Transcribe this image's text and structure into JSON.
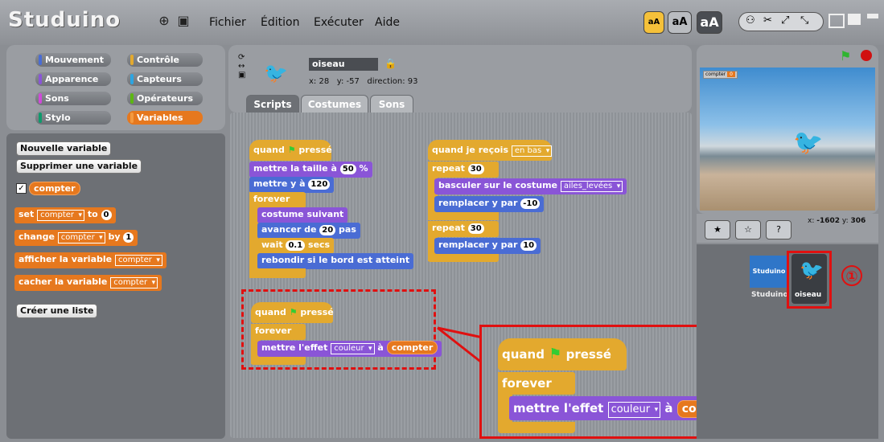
{
  "app": {
    "logo": "Studuino"
  },
  "menu": {
    "file": "Fichier",
    "edit": "Édition",
    "run": "Exécuter",
    "help": "Aide"
  },
  "toolbar": {
    "font_small": "aA",
    "font_medium": "aA",
    "font_large": "aA"
  },
  "categories": {
    "motion": "Mouvement",
    "control": "Contrôle",
    "looks": "Apparence",
    "sensing": "Capteurs",
    "sound": "Sons",
    "operators": "Opérateurs",
    "pen": "Stylo",
    "variables": "Variables"
  },
  "palette": {
    "new_var": "Nouvelle variable",
    "delete_var": "Supprimer une variable",
    "var_name": "compter",
    "set_label": "set",
    "set_to": "to",
    "set_value": "0",
    "change_label": "change",
    "change_by": "by",
    "change_value": "1",
    "show_var": "afficher la variable",
    "hide_var": "cacher la variable",
    "new_list": "Créer une liste"
  },
  "sprite": {
    "name": "oiseau",
    "x_label": "x:",
    "x": "28",
    "y_label": "y:",
    "y": "-57",
    "dir_label": "direction:",
    "direction": "93"
  },
  "tabs": {
    "scripts": "Scripts",
    "costumes": "Costumes",
    "sounds": "Sons"
  },
  "script1": {
    "hat": "quand",
    "hat_end": "pressé",
    "size": "mettre la taille à",
    "size_val": "50",
    "size_unit": "%",
    "sety": "mettre y à",
    "sety_val": "120",
    "forever": "forever",
    "next_costume": "costume suivant",
    "move": "avancer de",
    "move_val": "20",
    "move_unit": "pas",
    "wait": "wait",
    "wait_val": "0.1",
    "wait_unit": "secs",
    "bounce": "rebondir si le bord est atteint"
  },
  "script2": {
    "hat": "quand je reçois",
    "msg": "en bas",
    "repeat": "repeat",
    "repeat_val": "30",
    "switch": "basculer sur le costume",
    "costume": "ailes_levées",
    "changey": "remplacer y par",
    "changey_val": "-10",
    "repeat2_val": "30",
    "changey2_val": "10"
  },
  "script3": {
    "hat": "quand",
    "hat_end": "pressé",
    "forever": "forever",
    "effect": "mettre l'effet",
    "effect_name": "couleur",
    "to": "à",
    "var": "compter"
  },
  "stage": {
    "monitor_label": "compter",
    "monitor_value": "0",
    "mouse_x_label": "x:",
    "mouse_x": "-1602",
    "mouse_y_label": "y:",
    "mouse_y": "306"
  },
  "sprites_pane": {
    "stage_thumb": "Studuino",
    "stage_label": "Studuino",
    "sprite_label": "oiseau",
    "callout": "①"
  }
}
